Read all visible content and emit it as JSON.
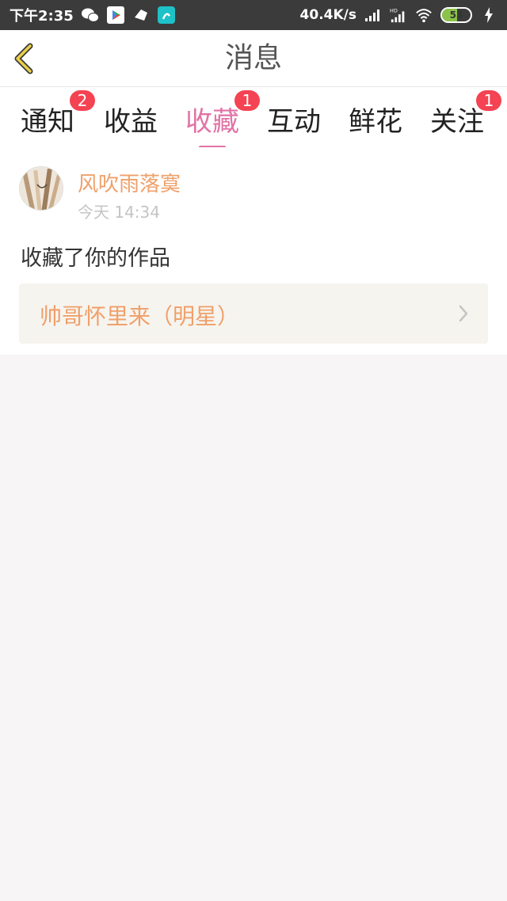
{
  "status_bar": {
    "time": "下午2:35",
    "net_speed": "40.4K/s",
    "battery_level": "53",
    "battery_percent": 53,
    "icons": [
      "wechat-icon",
      "play-store-icon",
      "app-icon",
      "app-icon-2",
      "signal-icon",
      "hd-signal-icon",
      "wifi-icon",
      "battery-icon",
      "charging-icon"
    ]
  },
  "header": {
    "title": "消息"
  },
  "tabs": [
    {
      "label": "通知",
      "badge": "2",
      "active": false
    },
    {
      "label": "收益",
      "badge": "",
      "active": false
    },
    {
      "label": "收藏",
      "badge": "1",
      "active": true
    },
    {
      "label": "互动",
      "badge": "",
      "active": false
    },
    {
      "label": "鲜花",
      "badge": "",
      "active": false
    },
    {
      "label": "关注",
      "badge": "1",
      "active": false
    }
  ],
  "message": {
    "username": "风吹雨落寞",
    "time": "今天 14:34",
    "action": "收藏了你的作品",
    "work_title": "帅哥怀里来（明星）"
  },
  "colors": {
    "accent": "#e173a6",
    "badge": "#f44352",
    "username": "#f0a06a",
    "back_arrow": "#e8d04a"
  }
}
